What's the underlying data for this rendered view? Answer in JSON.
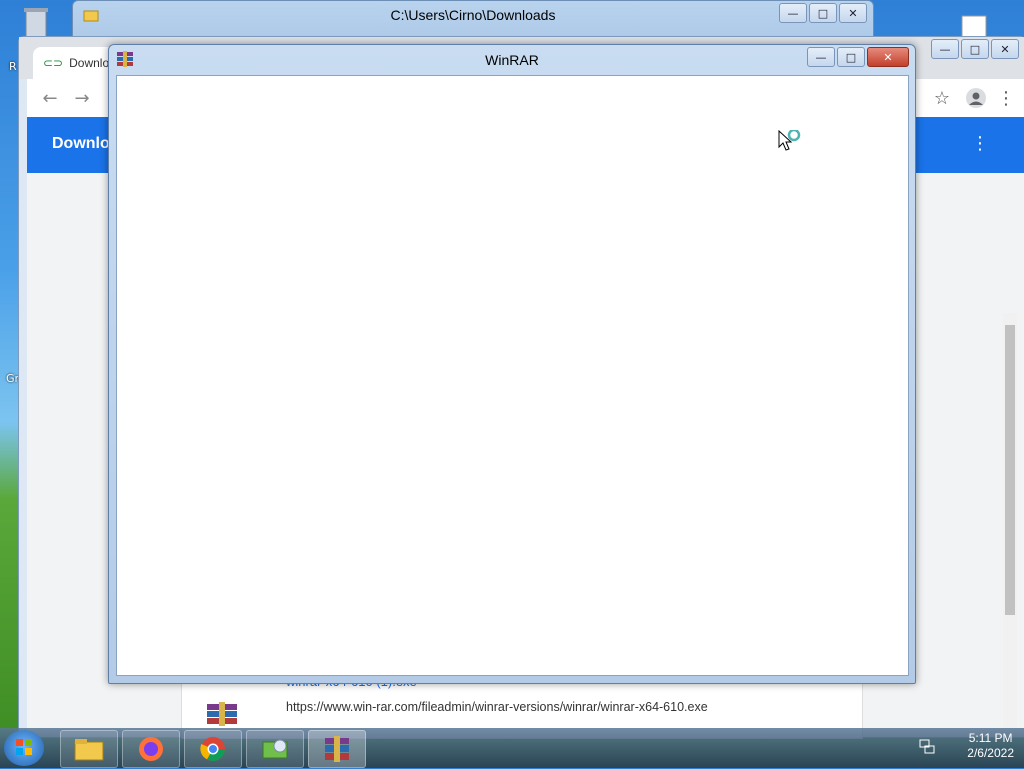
{
  "desktop": {
    "labels": [
      "R",
      "Gr"
    ]
  },
  "explorer": {
    "title": "C:\\Users\\Cirno\\Downloads"
  },
  "chrome": {
    "active_tab": "Downlo",
    "page_title": "Downlo",
    "download": {
      "filename": "winrar-x64-610 (1).exe",
      "url": "https://www.win-rar.com/fileadmin/winrar-versions/winrar/winrar-x64-610.exe"
    }
  },
  "winrar": {
    "title": "WinRAR"
  },
  "caption": {
    "minimize": "—",
    "maximize": "□",
    "close": "✕"
  },
  "taskbar": {
    "time": "5:11 PM",
    "date": "2/6/2022",
    "apps": [
      "file-explorer",
      "firefox",
      "chrome",
      "installer",
      "winrar"
    ]
  }
}
